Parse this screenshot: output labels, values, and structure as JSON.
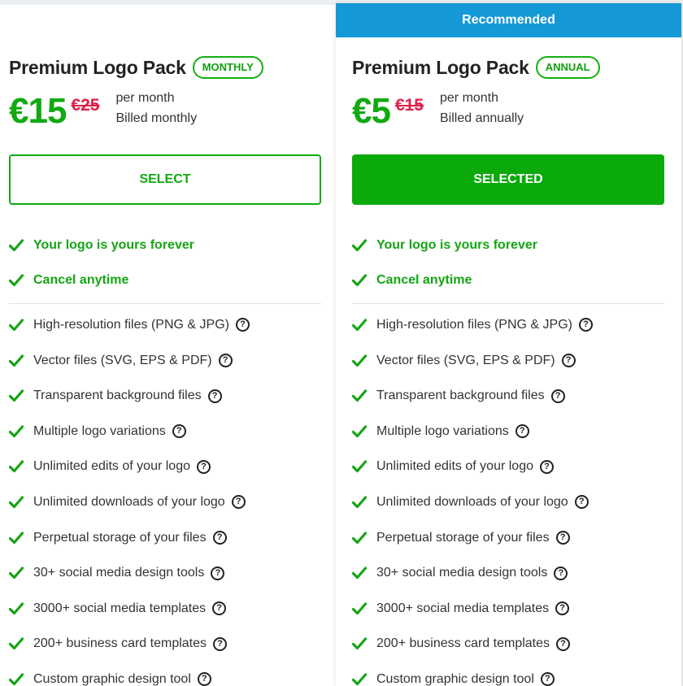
{
  "colors": {
    "accent_green": "#12a912",
    "strike_red": "#e0204a",
    "recommended_blue": "#1498d6"
  },
  "icons": {
    "check": "check-icon",
    "help": "help-circle-icon"
  },
  "plans": [
    {
      "recommended_label": "",
      "title": "Premium Logo Pack",
      "period_badge": "MONTHLY",
      "price": "€15",
      "old_price": "€25",
      "price_line_1": "per month",
      "price_line_2": "Billed monthly",
      "button_label": "SELECT",
      "selected": false
    },
    {
      "recommended_label": "Recommended",
      "title": "Premium Logo Pack",
      "period_badge": "ANNUAL",
      "price": "€5",
      "old_price": "€15",
      "price_line_1": "per month",
      "price_line_2": "Billed annually",
      "button_label": "SELECTED",
      "selected": true
    }
  ],
  "highlights": [
    "Your logo is yours forever",
    "Cancel anytime"
  ],
  "help_glyph": "?",
  "features": [
    "High-resolution files (PNG & JPG)",
    "Vector files (SVG, EPS & PDF)",
    "Transparent background files",
    "Multiple logo variations",
    "Unlimited edits of your logo",
    "Unlimited downloads of your logo",
    "Perpetual storage of your files",
    "30+ social media design tools",
    "3000+ social media templates",
    "200+ business card templates",
    "Custom graphic design tool"
  ]
}
